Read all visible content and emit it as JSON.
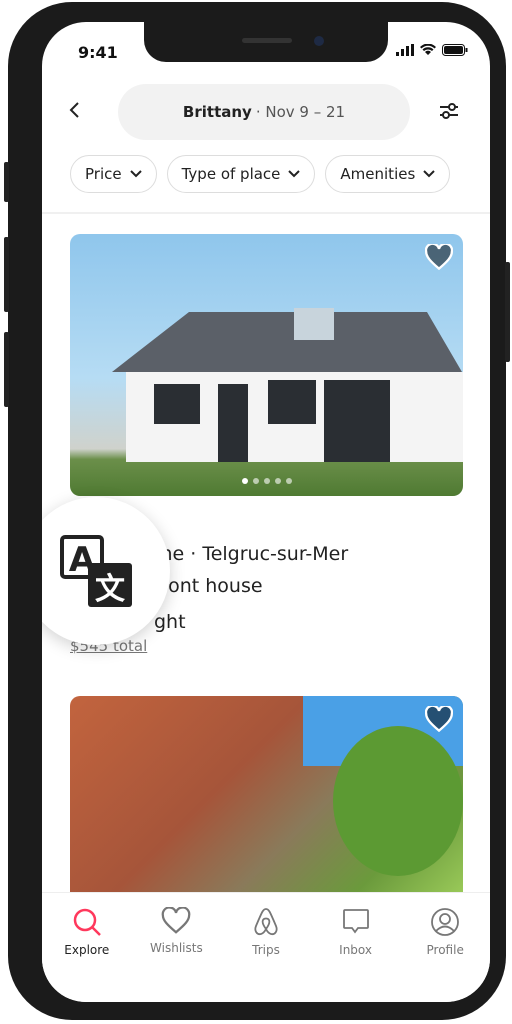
{
  "status": {
    "time": "9:41"
  },
  "header": {
    "location": "Brittany",
    "dates": "· Nov 9 – 21"
  },
  "filters": [
    {
      "label": "Price"
    },
    {
      "label": "Type of place"
    },
    {
      "label": "Amenities"
    }
  ],
  "listings": [
    {
      "line1": "me · Telgruc-sur-Mer",
      "line2": "front house",
      "price": "ght",
      "total": "$545 total"
    }
  ],
  "tabs": [
    {
      "label": "Explore",
      "icon": "search-icon",
      "active": true
    },
    {
      "label": "Wishlists",
      "icon": "heart-icon"
    },
    {
      "label": "Trips",
      "icon": "airbnb-logo-icon"
    },
    {
      "label": "Inbox",
      "icon": "message-icon"
    },
    {
      "label": "Profile",
      "icon": "profile-icon"
    }
  ],
  "colors": {
    "accent": "#ff385c"
  }
}
